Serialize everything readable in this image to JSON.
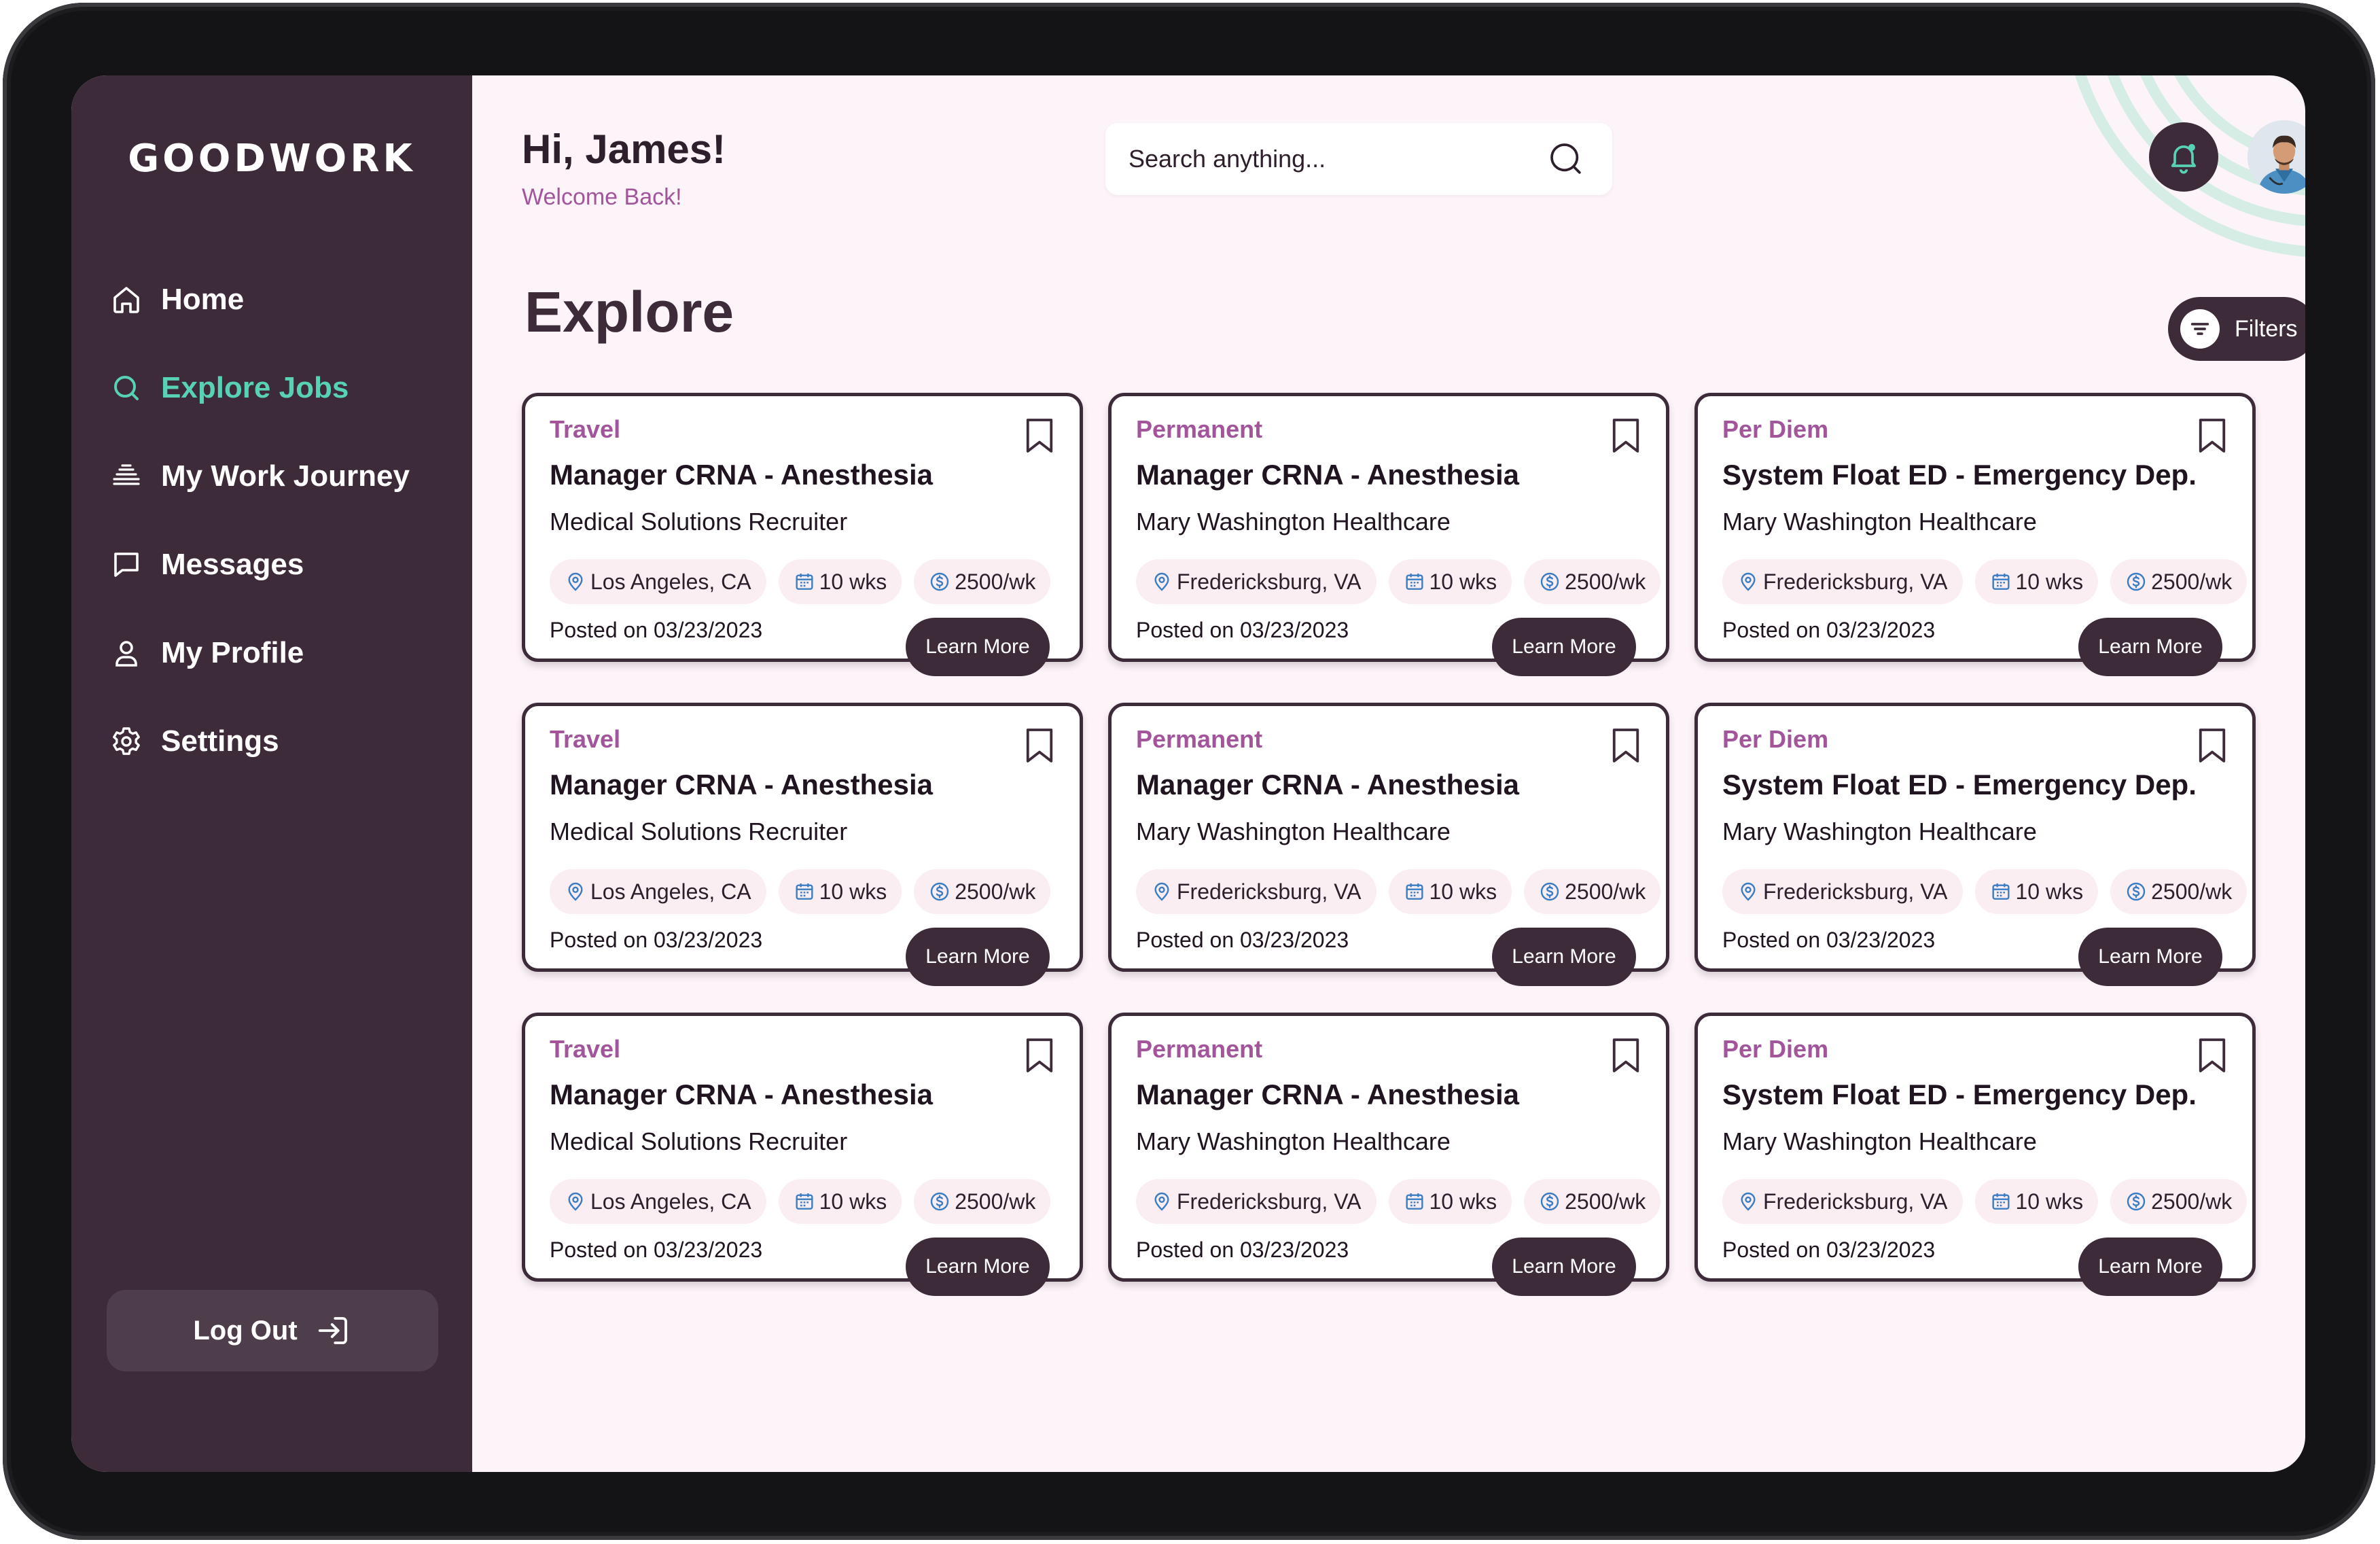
{
  "brand": {
    "logo": "GOODWORK"
  },
  "sidebar": {
    "items": [
      {
        "label": "Home",
        "icon": "home-icon"
      },
      {
        "label": "Explore Jobs",
        "icon": "search-icon",
        "active": true
      },
      {
        "label": "My Work Journey",
        "icon": "journey-icon"
      },
      {
        "label": "Messages",
        "icon": "message-icon"
      },
      {
        "label": "My Profile",
        "icon": "user-icon"
      },
      {
        "label": "Settings",
        "icon": "gear-icon"
      }
    ],
    "logout_label": "Log Out"
  },
  "header": {
    "greeting": "Hi, James!",
    "subtitle": "Welcome Back!",
    "search_placeholder": "Search anything..."
  },
  "page": {
    "title": "Explore",
    "filters_label": "Filters"
  },
  "colors": {
    "sidebar": "#3d2b3a",
    "accent_active": "#58d2b4",
    "job_type": "#a2559b",
    "background": "#fcf4f9",
    "chip": "#fbeef3"
  },
  "jobs": [
    {
      "type": "Travel",
      "title": "Manager CRNA - Anesthesia",
      "company": "Medical Solutions Recruiter",
      "location": "Los Angeles, CA",
      "duration": "10 wks",
      "pay": "2500/wk",
      "posted": "Posted on 03/23/2023",
      "cta": "Learn More"
    },
    {
      "type": "Permanent",
      "title": "Manager CRNA - Anesthesia",
      "company": "Mary Washington Healthcare",
      "location": "Fredericksburg, VA",
      "duration": "10 wks",
      "pay": "2500/wk",
      "posted": "Posted on 03/23/2023",
      "cta": "Learn More"
    },
    {
      "type": "Per Diem",
      "title": "System Float ED - Emergency Dep.",
      "company": "Mary Washington Healthcare",
      "location": "Fredericksburg, VA",
      "duration": "10 wks",
      "pay": "2500/wk",
      "posted": "Posted on 03/23/2023",
      "cta": "Learn More"
    },
    {
      "type": "Travel",
      "title": "Manager CRNA - Anesthesia",
      "company": "Medical Solutions Recruiter",
      "location": "Los Angeles, CA",
      "duration": "10 wks",
      "pay": "2500/wk",
      "posted": "Posted on 03/23/2023",
      "cta": "Learn More"
    },
    {
      "type": "Permanent",
      "title": "Manager CRNA - Anesthesia",
      "company": "Mary Washington Healthcare",
      "location": "Fredericksburg, VA",
      "duration": "10 wks",
      "pay": "2500/wk",
      "posted": "Posted on 03/23/2023",
      "cta": "Learn More"
    },
    {
      "type": "Per Diem",
      "title": "System Float ED - Emergency Dep.",
      "company": "Mary Washington Healthcare",
      "location": "Fredericksburg, VA",
      "duration": "10 wks",
      "pay": "2500/wk",
      "posted": "Posted on 03/23/2023",
      "cta": "Learn More"
    },
    {
      "type": "Travel",
      "title": "Manager CRNA - Anesthesia",
      "company": "Medical Solutions Recruiter",
      "location": "Los Angeles, CA",
      "duration": "10 wks",
      "pay": "2500/wk",
      "posted": "Posted on 03/23/2023",
      "cta": "Learn More"
    },
    {
      "type": "Permanent",
      "title": "Manager CRNA - Anesthesia",
      "company": "Mary Washington Healthcare",
      "location": "Fredericksburg, VA",
      "duration": "10 wks",
      "pay": "2500/wk",
      "posted": "Posted on 03/23/2023",
      "cta": "Learn More"
    },
    {
      "type": "Per Diem",
      "title": "System Float ED - Emergency Dep.",
      "company": "Mary Washington Healthcare",
      "location": "Fredericksburg, VA",
      "duration": "10 wks",
      "pay": "2500/wk",
      "posted": "Posted on 03/23/2023",
      "cta": "Learn More"
    }
  ]
}
